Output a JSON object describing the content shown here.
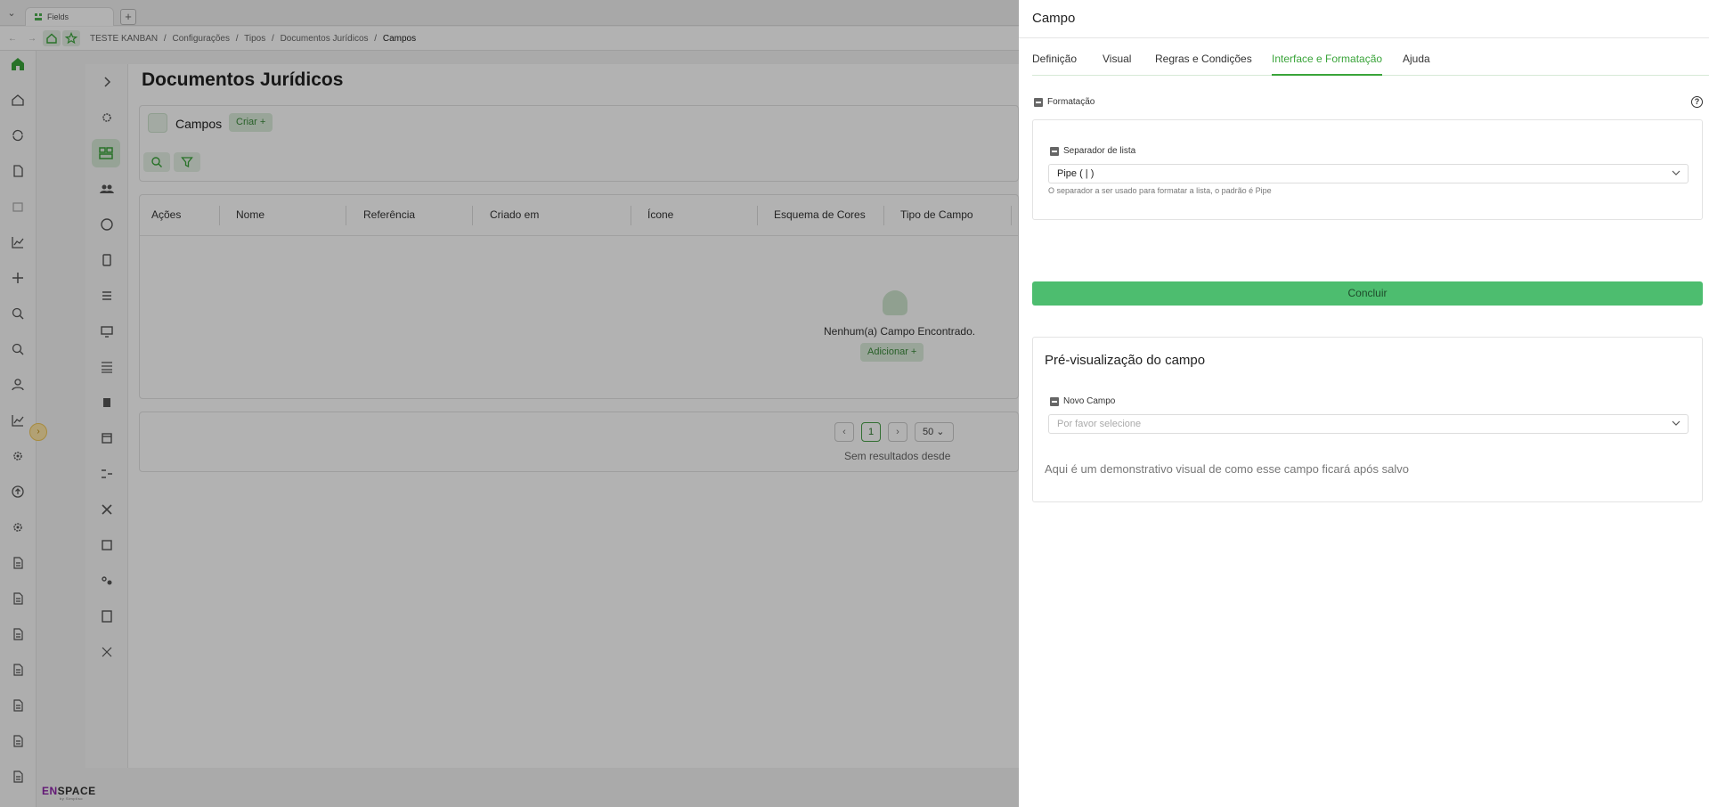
{
  "browser": {
    "tab_title": "Fields",
    "new_tab": "+"
  },
  "breadcrumb": [
    "TESTE KANBAN",
    "/",
    "Configurações",
    "/",
    "Tipos",
    "/",
    "Documentos Jurídicos",
    "/"
  ],
  "breadcrumb_current": "Campos",
  "page": {
    "title": "Documentos Jurídicos",
    "section_label": "Campos",
    "create_label": "Criar +"
  },
  "table": {
    "columns": [
      "Ações",
      "Nome",
      "Referência",
      "Criado em",
      "Ícone",
      "Esquema de Cores",
      "Tipo de Campo"
    ],
    "empty_message": "Nenhum(a) Campo Encontrado.",
    "add_label": "Adicionar +"
  },
  "pagination": {
    "current_page": "1",
    "page_size": "50",
    "status": "Sem resultados desde"
  },
  "logo": {
    "prefix": "EN",
    "rest": "SPACE",
    "tagline": "by Simpliso"
  },
  "panel": {
    "title": "Campo",
    "tabs": [
      "Definição",
      "Visual",
      "Regras e Condições",
      "Interface e Formatação",
      "Ajuda"
    ],
    "active_tab": "Interface e Formatação",
    "formatting": {
      "section_label": "Formatação",
      "field_label": "Separador de lista",
      "value": "Pipe ( | )",
      "hint": "O separador a ser usado para formatar a lista, o padrão é Pipe"
    },
    "done_label": "Concluir",
    "preview": {
      "title": "Pré-visualização do campo",
      "field_label": "Novo Campo",
      "placeholder": "Por favor selecione",
      "note": "Aqui é um demonstrativo visual de como esse campo ficará após salvo"
    }
  },
  "colors": {
    "accent": "#3aa43a",
    "button": "#4dbd6f",
    "overlay": "rgba(0,0,0,0.30)"
  }
}
